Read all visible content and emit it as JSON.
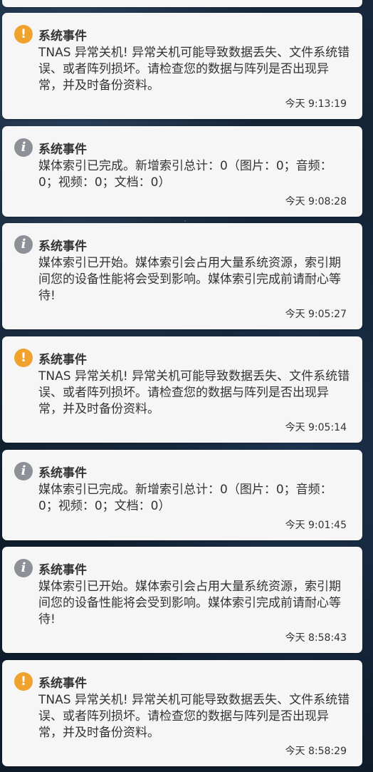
{
  "notifications": [
    {
      "type": "warning",
      "icon": "exclamation-icon",
      "title": "系统事件",
      "message": "TNAS 异常关机! 异常关机可能导致数据丢失、文件系统错误、或者阵列损坏。请检查您的数据与阵列是否出现异常，并及时备份资料。",
      "time": "今天 9:13:19"
    },
    {
      "type": "info",
      "icon": "info-icon",
      "title": "系统事件",
      "message": "媒体索引已完成。新增索引总计：0（图片：0；音频：0；视频：0；文档：0）",
      "time": "今天 9:08:28"
    },
    {
      "type": "info",
      "icon": "info-icon",
      "title": "系统事件",
      "message": "媒体索引已开始。媒体索引会占用大量系统资源，索引期间您的设备性能将会受到影响。媒体索引完成前请耐心等待!",
      "time": "今天 9:05:27"
    },
    {
      "type": "warning",
      "icon": "exclamation-icon",
      "title": "系统事件",
      "message": "TNAS 异常关机! 异常关机可能导致数据丢失、文件系统错误、或者阵列损坏。请检查您的数据与阵列是否出现异常，并及时备份资料。",
      "time": "今天 9:05:14"
    },
    {
      "type": "info",
      "icon": "info-icon",
      "title": "系统事件",
      "message": "媒体索引已完成。新增索引总计：0（图片：0；音频：0；视频：0；文档：0）",
      "time": "今天 9:01:45"
    },
    {
      "type": "info",
      "icon": "info-icon",
      "title": "系统事件",
      "message": "媒体索引已开始。媒体索引会占用大量系统资源，索引期间您的设备性能将会受到影响。媒体索引完成前请耐心等待!",
      "time": "今天 8:58:43"
    },
    {
      "type": "warning",
      "icon": "exclamation-icon",
      "title": "系统事件",
      "message": "TNAS 异常关机! 异常关机可能导致数据丢失、文件系统错误、或者阵列损坏。请检查您的数据与阵列是否出现异常，并及时备份资料。",
      "time": "今天 8:58:29"
    }
  ],
  "colors": {
    "warning": "#f0a22e",
    "info": "#8e9097",
    "card_background": "#f6f6f6",
    "text": "#333333"
  }
}
